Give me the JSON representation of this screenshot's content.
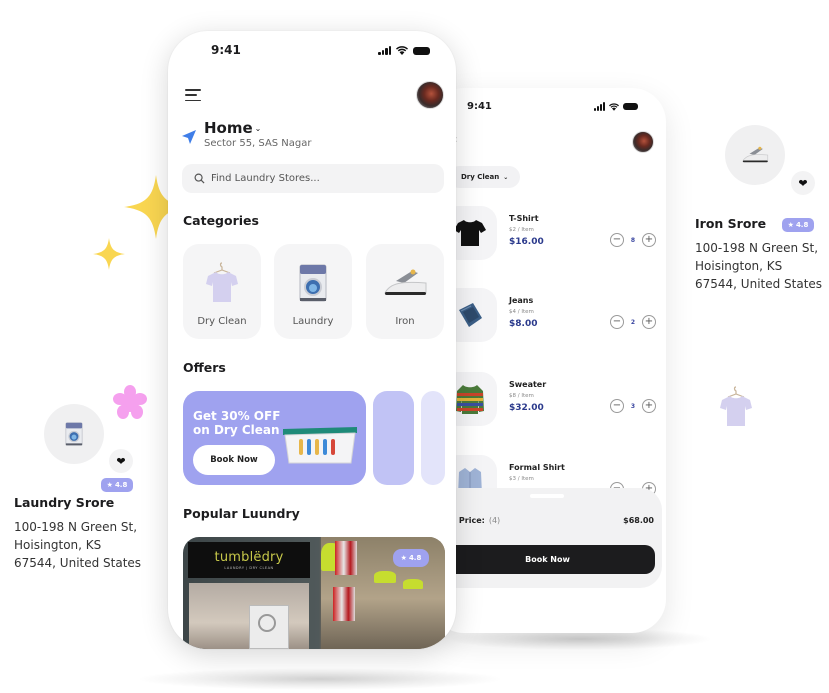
{
  "front_phone": {
    "status": {
      "time": "9:41"
    },
    "location": {
      "title": "Home",
      "subtitle": "Sector 55, SAS Nagar"
    },
    "search": {
      "placeholder": "Find Laundry Stores..."
    },
    "categories": {
      "title": "Categories",
      "items": [
        {
          "label": "Dry Clean",
          "icon": "tshirt-icon"
        },
        {
          "label": "Laundry",
          "icon": "washing-machine-icon"
        },
        {
          "label": "Iron",
          "icon": "iron-icon"
        }
      ]
    },
    "offers": {
      "title": "Offers",
      "main": {
        "line1": "Get 30% OFF",
        "line2": "on Dry Clean",
        "button": "Book Now"
      }
    },
    "popular": {
      "title": "Popular Luundry",
      "card": {
        "brand": "tumblëdry",
        "tagline": "LAUNDRY | DRY CLEAN",
        "rating": "4.8"
      }
    }
  },
  "back_phone": {
    "status": {
      "time": "9:41"
    },
    "filter": {
      "label": "Dry Clean"
    },
    "items": [
      {
        "name": "T-Shirt",
        "unit": "$2 / Item",
        "price": "$16.00",
        "qty": "8"
      },
      {
        "name": "Jeans",
        "unit": "$4 / Item",
        "price": "$8.00",
        "qty": "2"
      },
      {
        "name": "Sweater",
        "unit": "$8 / Item",
        "price": "$32.00",
        "qty": "3"
      },
      {
        "name": "Formal Shirt",
        "unit": "$3 / Item",
        "price": "",
        "qty": ""
      }
    ],
    "checkout": {
      "label": "al Price:",
      "count": "(4)",
      "total": "$68.00",
      "button": "Book Now"
    }
  },
  "float_right": {
    "name": "Iron Srore",
    "rating": "4.8",
    "address": [
      "100-198 N Green St,",
      "Hoisington, KS",
      "67544, United States"
    ]
  },
  "float_left": {
    "name": "Laundry Srore",
    "rating": "4.8",
    "address": [
      "100-198 N Green St,",
      "Hoisington, KS",
      "67544, United States"
    ]
  },
  "colors": {
    "accent": "#9fa2ef",
    "price_blue": "#2b3a8c",
    "star_yellow": "#f9d651",
    "flower_pink": "#f5a0ee",
    "dark_button": "#1c1c1e"
  }
}
